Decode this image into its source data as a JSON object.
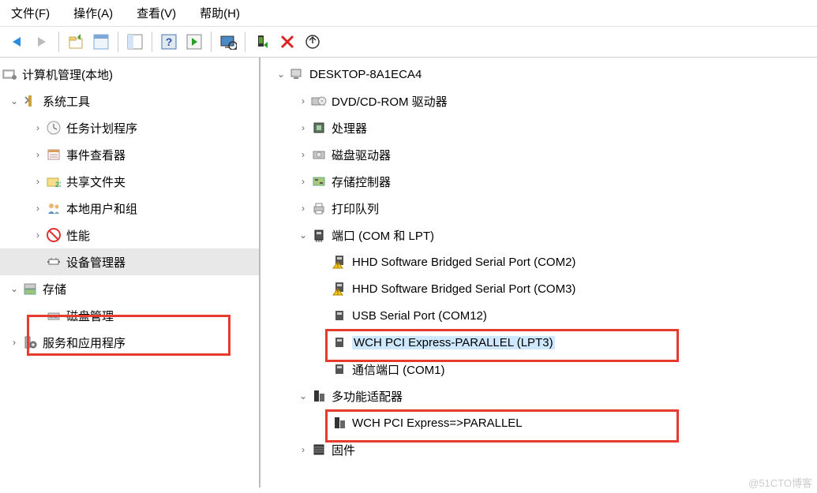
{
  "menu": {
    "file": "文件(F)",
    "action": "操作(A)",
    "view": "查看(V)",
    "help": "帮助(H)"
  },
  "left": {
    "root": "计算机管理(本地)",
    "system_tools": "系统工具",
    "task_scheduler": "任务计划程序",
    "event_viewer": "事件查看器",
    "shared_folders": "共享文件夹",
    "local_users": "本地用户和组",
    "performance": "性能",
    "device_manager": "设备管理器",
    "storage": "存储",
    "disk_management": "磁盘管理",
    "services_apps": "服务和应用程序"
  },
  "right": {
    "computer_name": "DESKTOP-8A1ECA4",
    "dvd": "DVD/CD-ROM 驱动器",
    "processors": "处理器",
    "disk_drives": "磁盘驱动器",
    "storage_controllers": "存储控制器",
    "print_queues": "打印队列",
    "ports": "端口 (COM 和 LPT)",
    "port_hhd1": "HHD Software Bridged Serial Port (COM2)",
    "port_hhd2": "HHD Software Bridged Serial Port (COM3)",
    "port_usb": "USB Serial Port (COM12)",
    "port_wch_lpt": "WCH PCI Express-PARALLEL (LPT3)",
    "port_comm": "通信端口 (COM1)",
    "multifunction": "多功能适配器",
    "wch_parallel": "WCH PCI Express=>PARALLEL",
    "firmware": "固件"
  },
  "watermark": "@51CTO博客"
}
